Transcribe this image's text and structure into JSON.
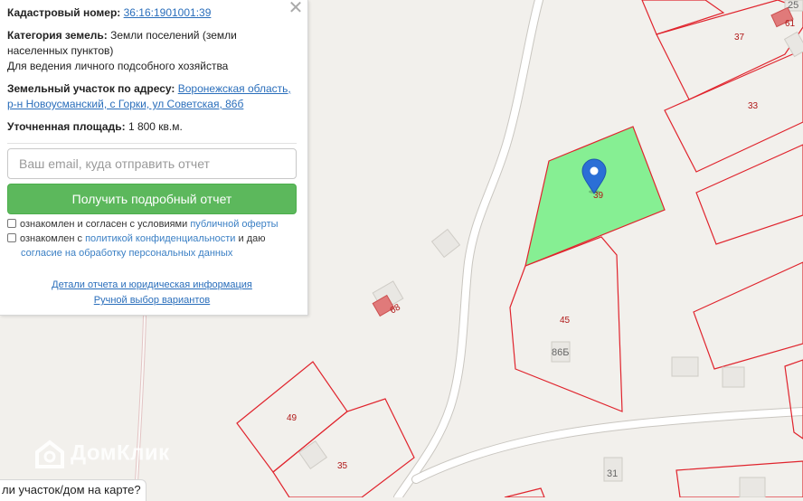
{
  "panel": {
    "cadastral_label": "Кадастровый номер:",
    "cadastral_number": "36:16:1901001:39",
    "category_label": "Категория земель:",
    "category_value_1": "Земли поселений (земли",
    "category_value_2": "населенных пунктов)",
    "category_value_3": "Для ведения личного подсобного хозяйства",
    "address_label": "Земельный участок по адресу:",
    "address_line_1": "Воронежская область,",
    "address_line_2": "р-н Новоусманский, с Горки, ул Советская, 86б",
    "area_label": "Уточненная площадь:",
    "area_value": "1 800 кв.м.",
    "email_placeholder": "Ваш email, куда отправить отчет",
    "report_button": "Получить подробный отчет",
    "consent_1_text": "ознакомлен и согласен с условиями",
    "consent_1_link": "публичной оферты",
    "consent_2_text_a": "ознакомлен с",
    "consent_2_link_a": "политикой конфиденциальности",
    "consent_2_text_b": "и даю",
    "consent_2_link_b": "согласие на обработку персональных данных",
    "details_link": "Детали отчета и юридическая информация",
    "manual_link": "Ручной выбор вариантов",
    "close_icon": "close-icon"
  },
  "bottom_prompt": "ли участок/дом на карте?",
  "watermark": "ДомКлик",
  "map": {
    "parcel_labels": [
      "61",
      "37",
      "33",
      "39",
      "45",
      "49",
      "35",
      "68"
    ],
    "house_labels": [
      "25",
      "86Б",
      "31"
    ],
    "selected_parcel_color": "#86ef93",
    "boundary_color": "#e0242d",
    "marker_color": "#2b6fd6"
  }
}
